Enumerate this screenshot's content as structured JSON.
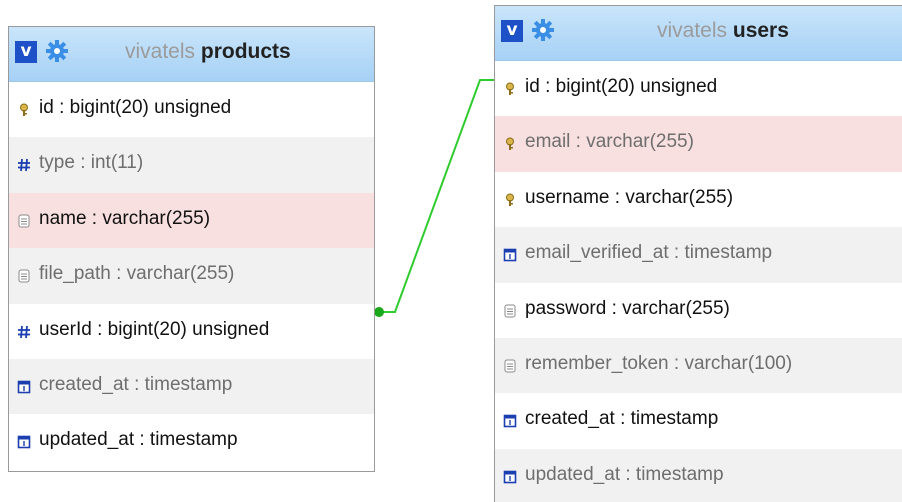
{
  "tables": {
    "products": {
      "db": "vivatels",
      "name": "products",
      "toggle_label": "v",
      "columns": [
        {
          "text": "id : bigint(20) unsigned",
          "icon": "key-icon"
        },
        {
          "text": "type : int(11)",
          "icon": "hash-icon"
        },
        {
          "text": "name : varchar(255)",
          "icon": "text-field-icon"
        },
        {
          "text": "file_path : varchar(255)",
          "icon": "text-field-icon"
        },
        {
          "text": "userId : bigint(20) unsigned",
          "icon": "hash-icon"
        },
        {
          "text": "created_at : timestamp",
          "icon": "timestamp-icon"
        },
        {
          "text": "updated_at : timestamp",
          "icon": "timestamp-icon"
        }
      ]
    },
    "users": {
      "db": "vivatels",
      "name": "users",
      "toggle_label": "v",
      "columns": [
        {
          "text": "id : bigint(20) unsigned",
          "icon": "key-icon"
        },
        {
          "text": "email : varchar(255)",
          "icon": "key-icon"
        },
        {
          "text": "username : varchar(255)",
          "icon": "key-icon"
        },
        {
          "text": "email_verified_at : timestamp",
          "icon": "timestamp-icon"
        },
        {
          "text": "password : varchar(255)",
          "icon": "text-field-icon"
        },
        {
          "text": "remember_token : varchar(100)",
          "icon": "text-field-icon"
        },
        {
          "text": "created_at : timestamp",
          "icon": "timestamp-icon"
        },
        {
          "text": "updated_at : timestamp",
          "icon": "timestamp-icon"
        }
      ]
    }
  },
  "relation": {
    "from": "products.userId",
    "to": "users.id",
    "color": "#2ecc2e"
  },
  "colors": {
    "header": "#a6d1f5",
    "toggle": "#1e50c8",
    "gear": "#3a8ee6",
    "highlight_row": "#f9e0e0",
    "alt_row": "#f1f1f1"
  }
}
